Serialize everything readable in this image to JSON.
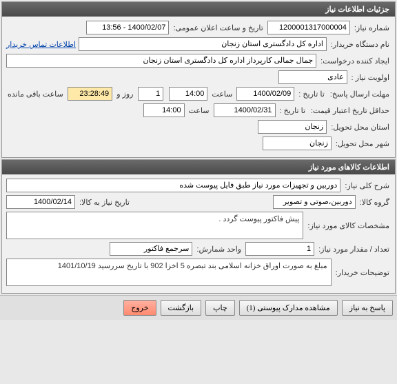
{
  "panel1": {
    "title": "جزئیات اطلاعات نیاز",
    "need_number_label": "شماره نیاز:",
    "need_number": "1200001317000004",
    "announce_date_label": "تاریخ و ساعت اعلان عمومی:",
    "announce_date": "1400/02/07 - 13:56",
    "buyer_org_label": "نام دستگاه خریدار:",
    "buyer_org": "اداره کل دادگستری استان زنجان",
    "contact_link": "اطلاعات تماس خریدار",
    "requester_label": "ایجاد کننده درخواست:",
    "requester": "جمال جمالی کارپرداز اداره کل دادگستری استان زنجان",
    "priority_label": "اولویت نیاز :",
    "priority": "عادی",
    "response_deadline_label": "مهلت ارسال پاسخ:",
    "to_date_label": "تا تاریخ :",
    "deadline_date": "1400/02/09",
    "time_label": "ساعت",
    "deadline_time": "14:00",
    "days_remaining": "1",
    "days_label": "روز و",
    "time_remaining": "23:28:49",
    "remaining_suffix": "ساعت باقی مانده",
    "min_credit_label": "حداقل تاریخ اعتبار قیمت:",
    "credit_to_label": "تا تاریخ :",
    "credit_date": "1400/02/31",
    "credit_time": "14:00",
    "delivery_province_label": "استان محل تحویل:",
    "delivery_province": "زنجان",
    "delivery_city_label": "شهر محل تحویل:",
    "delivery_city": "زنجان"
  },
  "panel2": {
    "title": "اطلاعات کالاهای مورد نیاز",
    "general_desc_label": "شرح کلی نیاز:",
    "general_desc": "دوربین و تجهیزات مورد نیاز طبق فایل پیوست شده",
    "goods_group_label": "گروه کالا:",
    "goods_group": "دوربین،صوتی و تصویر",
    "need_date_to_label": "تاریخ نیاز به کالا:",
    "need_date_to": "1400/02/14",
    "goods_spec_label": "مشخصات کالای مورد نیاز:",
    "goods_spec": "پیش فاکتور پیوست گردد .",
    "qty_label": "تعداد / مقدار مورد نیاز:",
    "qty": "1",
    "unit_label": "واحد شمارش:",
    "unit": "سرجمع فاکتور",
    "buyer_notes_label": "توضیحات خریدار:",
    "buyer_notes": "مبلغ به صورت اوراق خزانه اسلامی بند تبصره 5  اخزا 902 با تاریخ سررسید 1401/10/19"
  },
  "buttons": {
    "respond": "پاسخ به نیاز",
    "attachments": "مشاهده مدارک پیوستی  (1)",
    "print": "چاپ",
    "back": "بازگشت",
    "exit": "خروج"
  }
}
